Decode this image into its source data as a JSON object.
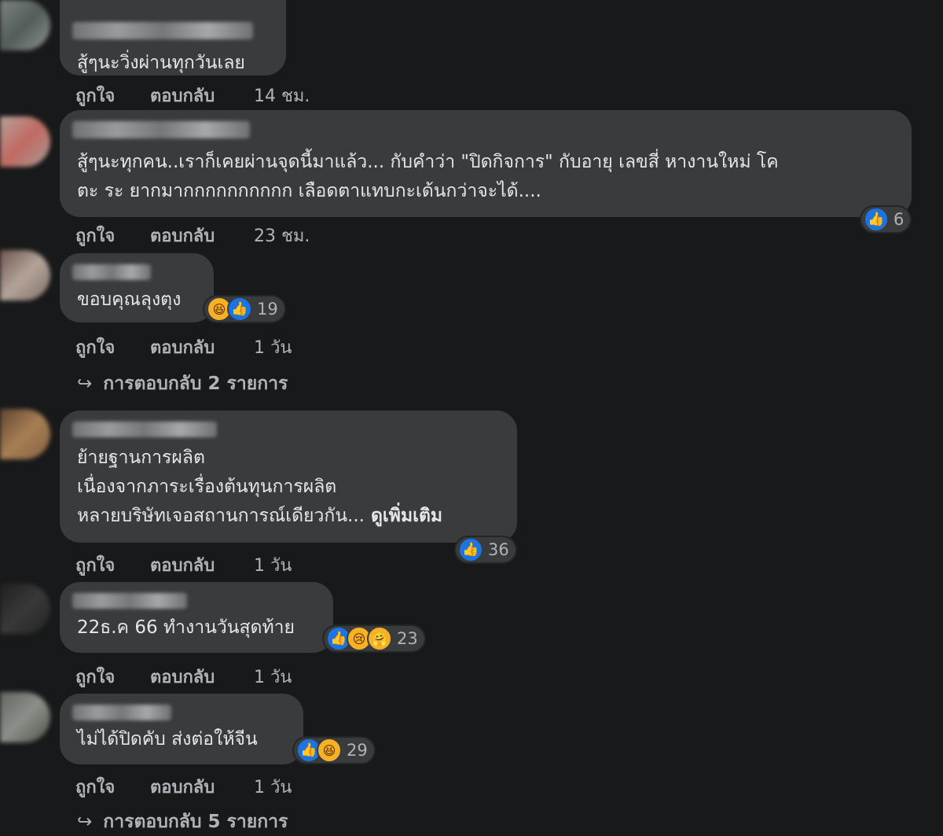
{
  "actions": {
    "like": "ถูกใจ",
    "reply": "ตอบกลับ"
  },
  "comments": [
    {
      "text": "สู้ๆนะวิ่งผ่านทุกวันเลย",
      "time": "14 ชม.",
      "reactions": {
        "count": ""
      }
    },
    {
      "text": "สู้ๆนะทุกคน..เราก็เคยผ่านจุดนี้มาแล้ว... กับคำว่า \"ปิดกิจการ\" กับอายุ เลขสี่ หางานใหม่ โค\nตะ ระ ยากมากกกกกกกกกก เลือดตาแทบกะเด้นกว่าจะได้....",
      "time": "23 ชม.",
      "reactions": {
        "count": "6"
      }
    },
    {
      "text": "ขอบคุณลุงตุง",
      "time": "1 วัน",
      "reactions": {
        "count": "19"
      }
    },
    {
      "text": "ย้ายฐานการผลิต\nเนื่องจากภาระเรื่องต้นทุนการผลิต\nหลายบริษัทเจอสถานการณ์เดียวกัน...",
      "see_more": "ดูเพิ่มเติม",
      "time": "1 วัน",
      "reactions": {
        "count": "36"
      }
    },
    {
      "text": "22ธ.ค 66 ทำงานวันสุดท้าย",
      "time": "1 วัน",
      "reactions": {
        "count": "23"
      }
    },
    {
      "text": "ไม่ได้ปิดคับ ส่งต่อให้จีน",
      "time": "1 วัน",
      "reactions": {
        "count": "29"
      }
    }
  ],
  "replies": [
    {
      "label": "การตอบกลับ 2 รายการ"
    },
    {
      "label": "การตอบกลับ 5 รายการ"
    }
  ],
  "icons": {
    "like": "like-icon",
    "haha": "haha-icon",
    "sad": "sad-icon",
    "care": "care-icon",
    "reply_arrow": "reply-arrow-icon"
  },
  "colors": {
    "background": "#18191a",
    "bubble": "#3a3b3c",
    "like_blue": "#1b74e4",
    "emoji_yellow": "#f7b125",
    "secondary_text": "#b0b3b8"
  }
}
